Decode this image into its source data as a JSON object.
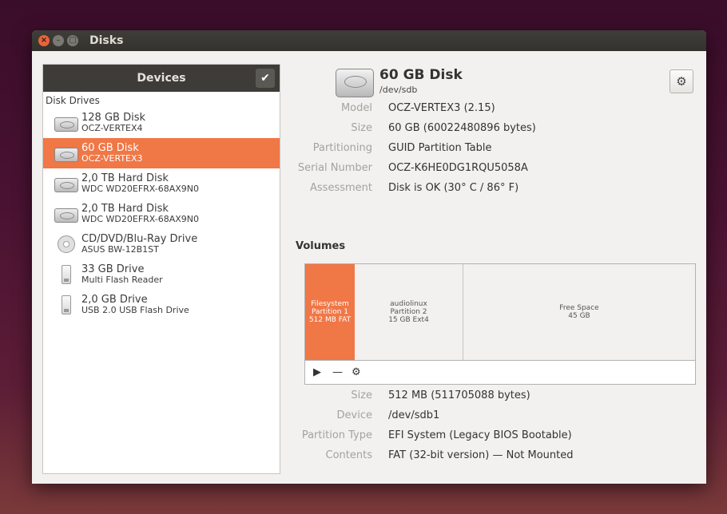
{
  "window": {
    "title": "Disks"
  },
  "devices": {
    "header": "Devices",
    "section": "Disk Drives",
    "items": [
      {
        "name": "128 GB Disk",
        "sub": "OCZ-VERTEX4",
        "icon": "hard-disk-icon"
      },
      {
        "name": "60 GB Disk",
        "sub": "OCZ-VERTEX3",
        "icon": "hard-disk-icon",
        "selected": true
      },
      {
        "name": "2,0 TB Hard Disk",
        "sub": "WDC WD20EFRX-68AX9N0",
        "icon": "hard-disk-icon"
      },
      {
        "name": "2,0 TB Hard Disk",
        "sub": "WDC WD20EFRX-68AX9N0",
        "icon": "hard-disk-icon"
      },
      {
        "name": "CD/DVD/Blu-Ray Drive",
        "sub": "ASUS   BW-12B1ST",
        "icon": "optical-disc-icon"
      },
      {
        "name": "33 GB Drive",
        "sub": "Multi Flash Reader",
        "icon": "usb-drive-icon"
      },
      {
        "name": "2,0 GB Drive",
        "sub": "USB 2.0 USB Flash Drive",
        "icon": "usb-drive-icon"
      }
    ]
  },
  "disk": {
    "title": "60 GB Disk",
    "path": "/dev/sdb",
    "props": [
      {
        "key": "Model",
        "value": "OCZ-VERTEX3 (2.15)"
      },
      {
        "key": "Size",
        "value": "60 GB (60022480896 bytes)"
      },
      {
        "key": "Partitioning",
        "value": "GUID Partition Table"
      },
      {
        "key": "Serial Number",
        "value": "OCZ-K6HE0DG1RQU5058A"
      },
      {
        "key": "Assessment",
        "value": "Disk is OK (30° C / 86° F)"
      }
    ]
  },
  "volumes": {
    "title": "Volumes",
    "partitions": [
      {
        "l1": "Filesystem",
        "l2": "Partition 1",
        "l3": "512 MB FAT"
      },
      {
        "l1": "audiolinux",
        "l2": "Partition 2",
        "l3": "15 GB Ext4"
      },
      {
        "l1": "Free Space",
        "l2": "45 GB",
        "l3": ""
      }
    ],
    "tools": [
      "▶",
      "—",
      "⚙"
    ]
  },
  "partition": {
    "props": [
      {
        "key": "Size",
        "value": "512 MB (511705088 bytes)"
      },
      {
        "key": "Device",
        "value": "/dev/sdb1"
      },
      {
        "key": "Partition Type",
        "value": "EFI System (Legacy BIOS Bootable)"
      },
      {
        "key": "Contents",
        "value": "FAT (32-bit version) — Not Mounted"
      }
    ]
  },
  "colors": {
    "accent": "#f07746",
    "titlebar": "#3d3c38"
  }
}
